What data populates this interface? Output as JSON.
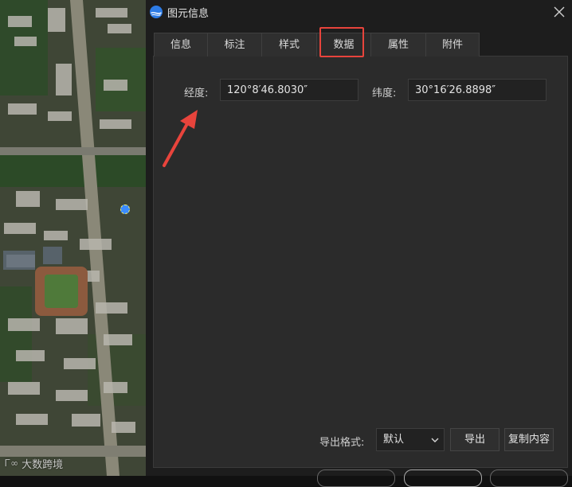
{
  "window": {
    "title": "图元信息",
    "close_glyph": "✕",
    "icons": {
      "app": "globe-logo-icon",
      "close": "close-icon"
    }
  },
  "tabs": [
    {
      "label": "信息",
      "active": false
    },
    {
      "label": "标注",
      "active": false
    },
    {
      "label": "样式",
      "active": false
    },
    {
      "label": "数据",
      "active": true
    },
    {
      "label": "属性",
      "active": false
    },
    {
      "label": "附件",
      "active": false
    }
  ],
  "coordinates": {
    "longitude_label": "经度:",
    "longitude_value": "120°8′46.8030″",
    "latitude_label": "纬度:",
    "latitude_value": "30°16′26.8898″"
  },
  "export": {
    "format_label": "导出格式:",
    "format_value": "默认",
    "export_button": "导出",
    "copy_button": "复制内容"
  },
  "map": {
    "watermark": "大数跨境",
    "watermark_logo": "Ꮁ∞"
  },
  "colors": {
    "dialog_bg": "#1d1d1d",
    "panel_bg": "#2b2b2b",
    "annotation_red": "#e8443c",
    "marker_blue": "#3b8cff"
  }
}
